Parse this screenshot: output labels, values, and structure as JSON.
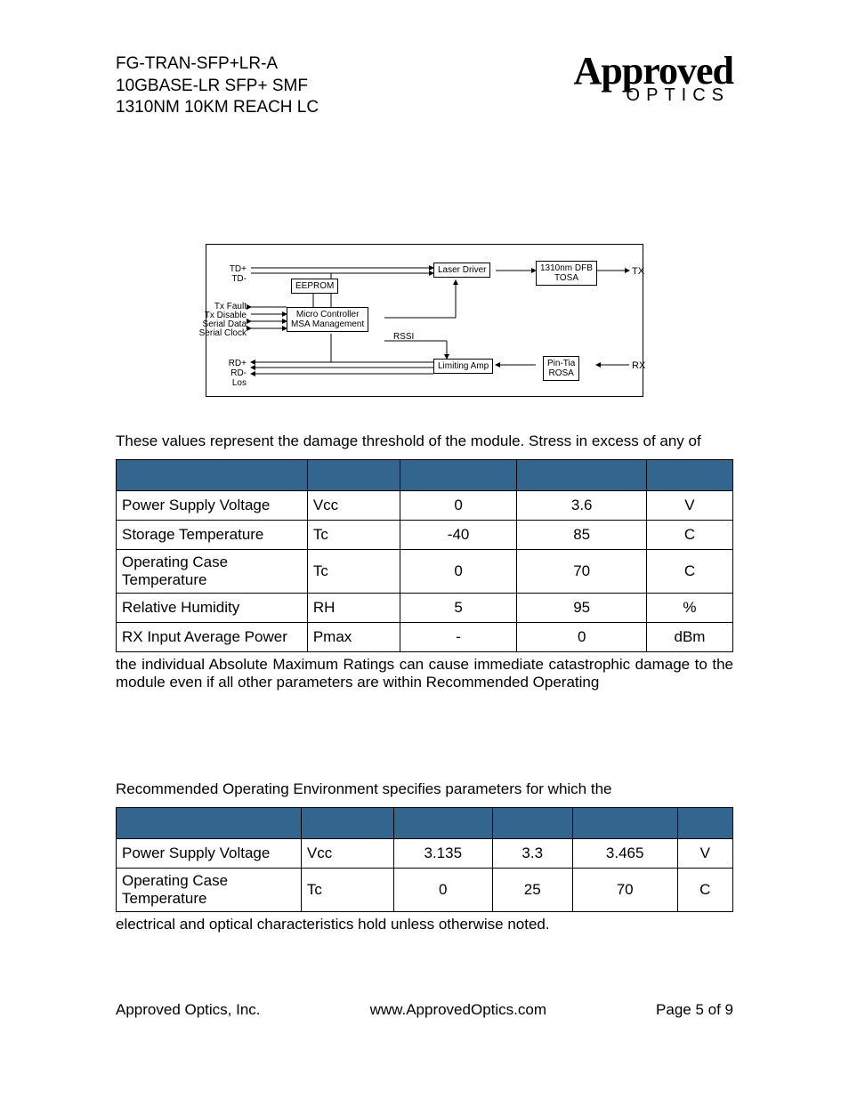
{
  "header": {
    "line1": "FG-TRAN-SFP+LR-A",
    "line2": "10GBASE-LR SFP+ SMF",
    "line3": "1310NM 10KM REACH LC"
  },
  "logo": {
    "main": "Approved",
    "sub": "OPTICS"
  },
  "diagram": {
    "left_labels": {
      "td": "TD+\nTD-",
      "txfault": "Tx Fault",
      "txdisable": "Tx Disable",
      "serialdata": "Serial Data",
      "serialclock": "Serial Clock",
      "rd": "RD+\nRD-\nLos"
    },
    "boxes": {
      "eeprom": "EEPROM",
      "micro": "Micro Controller\nMSA Management",
      "laser_driver": "Laser Driver",
      "limiting_amp": "Limiting Amp",
      "tosa": "1310nm DFB\nTOSA",
      "rosa": "Pin-Tia\nROSA"
    },
    "mid_label": "RSSI",
    "right_labels": {
      "tx": "TX",
      "rx": "RX"
    }
  },
  "section1": {
    "intro": "These values represent the damage threshold of the module. Stress in excess of any of",
    "after": "the individual Absolute Maximum Ratings can cause immediate catastrophic damage to the module even if all other parameters are within Recommended Operating",
    "rows": [
      {
        "param": "Power Supply Voltage",
        "sym": "Vcc",
        "min": "0",
        "max": "3.6",
        "unit": "V"
      },
      {
        "param": "Storage Temperature",
        "sym": "Tc",
        "min": "-40",
        "max": "85",
        "unit": "C"
      },
      {
        "param": "Operating Case Temperature",
        "sym": "Tc",
        "min": "0",
        "max": "70",
        "unit": "C"
      },
      {
        "param": "Relative Humidity",
        "sym": "RH",
        "min": "5",
        "max": "95",
        "unit": "%"
      },
      {
        "param": "RX Input Average Power",
        "sym": "Pmax",
        "min": "-",
        "max": "0",
        "unit": "dBm"
      }
    ]
  },
  "section2": {
    "intro": "Recommended Operating Environment specifies parameters for which the",
    "after": "electrical and optical characteristics hold unless otherwise noted.",
    "rows": [
      {
        "param": "Power Supply Voltage",
        "sym": "Vcc",
        "min": "3.135",
        "typ": "3.3",
        "max": "3.465",
        "unit": "V"
      },
      {
        "param": "Operating Case Temperature",
        "sym": "Tc",
        "min": "0",
        "typ": "25",
        "max": "70",
        "unit": "C"
      }
    ]
  },
  "footer": {
    "company": "Approved Optics, Inc.",
    "url": "www.ApprovedOptics.com",
    "page": "Page 5 of 9"
  }
}
